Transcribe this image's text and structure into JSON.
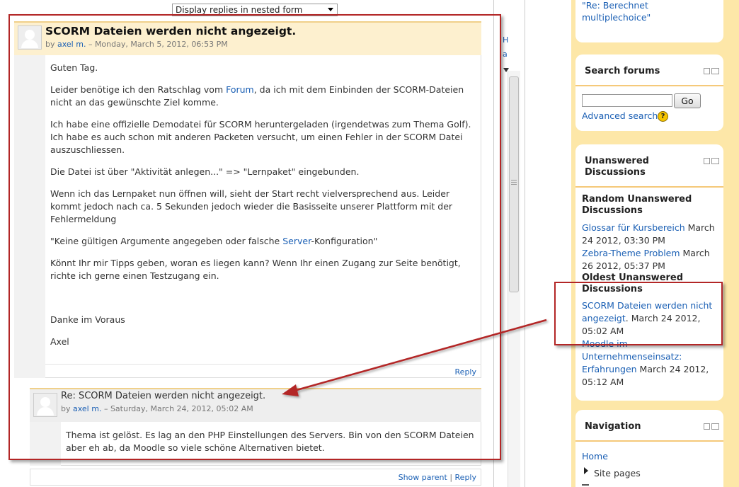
{
  "toolbar": {
    "display_mode": "Display replies in nested form"
  },
  "post1": {
    "subject": "SCORM Dateien werden nicht angezeigt.",
    "by": "by",
    "author": "axel m.",
    "date": " – Monday, March 5, 2012, 06:53 PM",
    "p1": "Guten Tag.",
    "p2a": "Leider benötige ich den Ratschlag vom ",
    "p2link": "Forum",
    "p2b": ", da ich mit dem Einbinden der SCORM-Dateien",
    "p2c": "nicht an das gewünschte Ziel komme.",
    "p3a": "Ich habe eine offizielle Demodatei für SCORM heruntergeladen (irgendetwas zum Thema Golf).",
    "p3b": "Ich habe es auch schon mit anderen Packeten versucht, um einen Fehler in der SCORM Datei",
    "p3c": "auszuschliessen.",
    "p4": "Die Datei ist über \"Aktivität anlegen...\" => \"Lernpaket\" eingebunden.",
    "p5a": "Wenn ich das Lernpaket nun öffnen will, sieht der Start recht vielversprechend aus. Leider",
    "p5b": "kommt jedoch nach ca. 5 Sekunden jedoch wieder die Basisseite unserer Plattform mit der",
    "p5c": "Fehlermeldung",
    "p6a": "\"Keine gültigen Argumente angegeben oder falsche ",
    "p6link": "Server",
    "p6b": "-Konfiguration\"",
    "p7a": "Könnt Ihr mir Tipps geben, woran es liegen kann? Wenn Ihr einen Zugang zur Seite benötigt,",
    "p7b": "richte ich gerne einen Testzugang ein.",
    "p8": "Danke im Voraus",
    "p9": "Axel",
    "reply": "Reply"
  },
  "post2": {
    "subject": "Re: SCORM Dateien werden nicht angezeigt.",
    "by": "by",
    "author": "axel m.",
    "date": " – Saturday, March 24, 2012, 05:02 AM",
    "l1": "Thema ist gelöst. Es lag an den PHP Einstellungen des Servers. Bin von den SCORM Dateien",
    "l2": "aber eh ab, da Moodle so viele schöne Alternativen bietet.",
    "show_parent": "Show parent",
    "sep": " | ",
    "reply": "Reply"
  },
  "sidebar": {
    "top_link_1": "\"Re: Berechnet",
    "top_link_2": "multiplechoice\"",
    "search": {
      "title": "Search forums",
      "go": "Go",
      "advanced": "Advanced search",
      "help": "?"
    },
    "unanswered": {
      "title_1": "Unanswered",
      "title_2": "Discussions",
      "random_1": "Random Unanswered",
      "random_2": "Discussions",
      "item1_link": "Glossar für Kursbereich",
      "item1_date_a": " March",
      "item1_date_b": "24 2012, 03:30 PM",
      "item2_link": "Zebra-Theme Problem",
      "item2_date_a": " March",
      "item2_date_b": "26 2012, 05:37 PM",
      "oldest_1": "Oldest Unanswered",
      "oldest_2": "Discussions",
      "item3_link_a": "SCORM Dateien werden nicht",
      "item3_link_b": "angezeigt",
      "item3_date_a": ". March 24 2012,",
      "item3_date_b": "05:02 AM",
      "item4_link_a": "Moodle im",
      "item4_link_b": "Unternehmenseinsatz:",
      "item4_link_c": "Erfahrungen",
      "item4_date_a": " March 24 2012,",
      "item4_date_b": "05:12 AM"
    },
    "navigation": {
      "title": "Navigation",
      "home": "Home",
      "site_pages": "Site pages"
    }
  },
  "colors": {
    "accent_sidebar": "#fde7a8",
    "annotation_red": "#b32626",
    "link": "#1a5fb4"
  }
}
